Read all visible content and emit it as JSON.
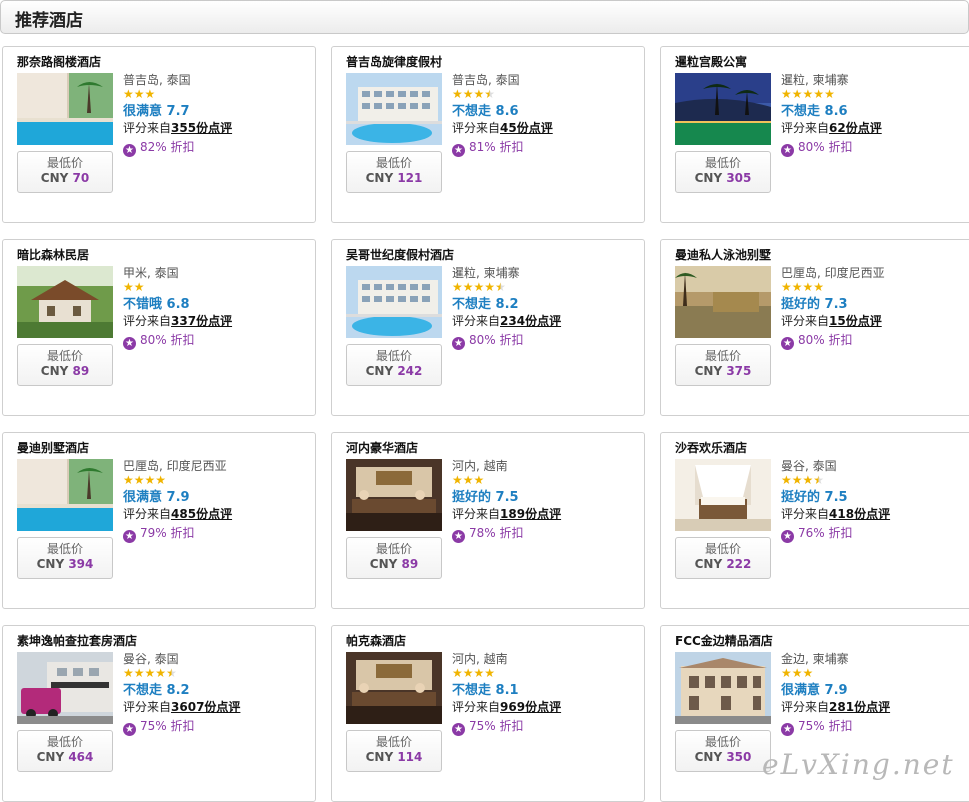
{
  "section_title": "推荐酒店",
  "price_label": "最低价",
  "currency": "CNY",
  "review_prefix": "评分来自",
  "review_suffix": "份点评",
  "discount_suffix": "折扣",
  "star_icon": "star-icon",
  "discount_icon": "discount-badge-icon",
  "colors": {
    "rating": "#1e7fc1",
    "price": "#8b3aa6",
    "stars": "#f0b400"
  },
  "hotels": [
    {
      "name": "那奈路阁楼酒店",
      "location": "普吉岛, 泰国",
      "stars": 3,
      "rating": "很满意 7.7",
      "reviews": "355",
      "discount": "82%",
      "price": "70",
      "thumb": "pool"
    },
    {
      "name": "普吉岛旋律度假村",
      "location": "普吉岛, 泰国",
      "stars": 3.5,
      "rating": "不想走 8.6",
      "reviews": "45",
      "discount": "81%",
      "price": "121",
      "thumb": "resort"
    },
    {
      "name": "暹粒宫殿公寓",
      "location": "暹粒, 柬埔寨",
      "stars": 5,
      "rating": "不想走 8.6",
      "reviews": "62",
      "discount": "80%",
      "price": "305",
      "thumb": "night"
    },
    {
      "name": "暗比森林民居",
      "location": "甲米, 泰国",
      "stars": 2,
      "rating": "不错哦 6.8",
      "reviews": "337",
      "discount": "80%",
      "price": "89",
      "thumb": "house"
    },
    {
      "name": "吴哥世纪度假村酒店",
      "location": "暹粒, 柬埔寨",
      "stars": 4.5,
      "rating": "不想走 8.2",
      "reviews": "234",
      "discount": "80%",
      "price": "242",
      "thumb": "resort"
    },
    {
      "name": "曼迪私人泳池别墅",
      "location": "巴厘岛, 印度尼西亚",
      "stars": 4,
      "rating": "挺好的 7.3",
      "reviews": "15",
      "discount": "80%",
      "price": "375",
      "thumb": "garden"
    },
    {
      "name": "曼迪别墅酒店",
      "location": "巴厘岛, 印度尼西亚",
      "stars": 4,
      "rating": "很满意 7.9",
      "reviews": "485",
      "discount": "79%",
      "price": "394",
      "thumb": "pool"
    },
    {
      "name": "河内豪华酒店",
      "location": "河内, 越南",
      "stars": 3,
      "rating": "挺好的 7.5",
      "reviews": "189",
      "discount": "78%",
      "price": "89",
      "thumb": "lobby"
    },
    {
      "name": "沙吞欢乐酒店",
      "location": "曼谷, 泰国",
      "stars": 3.5,
      "rating": "挺好的 7.5",
      "reviews": "418",
      "discount": "76%",
      "price": "222",
      "thumb": "room"
    },
    {
      "name": "素坤逸帕查拉套房酒店",
      "location": "曼谷, 泰国",
      "stars": 4.5,
      "rating": "不想走 8.2",
      "reviews": "3607",
      "discount": "75%",
      "price": "464",
      "thumb": "street"
    },
    {
      "name": "帕克森酒店",
      "location": "河内, 越南",
      "stars": 4,
      "rating": "不想走 8.1",
      "reviews": "969",
      "discount": "75%",
      "price": "114",
      "thumb": "lobby"
    },
    {
      "name": "FCC金边精品酒店",
      "location": "金边, 柬埔寨",
      "stars": 3,
      "rating": "很满意 7.9",
      "reviews": "281",
      "discount": "75%",
      "price": "350",
      "thumb": "building"
    }
  ],
  "watermark": "eLvXing.net"
}
